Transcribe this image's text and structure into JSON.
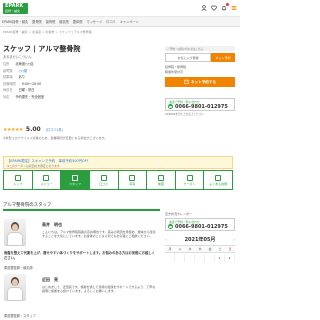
{
  "header": {
    "logo": "EPARK",
    "logo_sub": "接骨・鍼灸",
    "icons": [
      "user-icon",
      "heart-icon",
      "bell-icon",
      "menu-icon"
    ]
  },
  "nav": {
    "items": [
      "EPARK接骨・鍼灸",
      "整骨院",
      "接骨院",
      "鍼灸院",
      "整体院",
      "マッサージ",
      "口コミ",
      "キャンペーン"
    ]
  },
  "breadcrumb": "EPARK接骨・鍼灸 > 北海道 > 札幌市 > スケッフ | アルマ整骨院",
  "clinic": {
    "title": "スケッフ | アルマ整骨院",
    "subtitle": "あるませいこついん",
    "info": [
      {
        "key": "住所",
        "value": "北海道○○区"
      },
      {
        "key": "最寄駅",
        "value": "○○駅"
      },
      {
        "key": "駐車場",
        "value": "あり"
      },
      {
        "key": "診療時間",
        "value": "9:00〜20:00"
      },
      {
        "key": "休診日",
        "value": "日曜・祝日"
      },
      {
        "key": "対応",
        "value": "予約優先・完全個室"
      }
    ],
    "rating": {
      "stars": "★★★★★",
      "score": "5.00",
      "reviews": "（口コミ1件）"
    },
    "notice": "※新型コロナウイルス対策のため、営業時間が変更になる場合がございます。"
  },
  "banner": {
    "title": "【EPARK限定】スキャンで予約　事前予約500円OFF",
    "sub": "※このクーポンは初回の方限定となります"
  },
  "tabs": [
    {
      "label": "トップ",
      "icon": "home-icon",
      "active": false
    },
    {
      "label": "メニュー",
      "icon": "menu-list-icon",
      "active": false
    },
    {
      "label": "スタッフ",
      "icon": "staff-icon",
      "active": true
    },
    {
      "label": "口コミ",
      "icon": "review-icon",
      "active": false
    },
    {
      "label": "写真",
      "icon": "photo-icon",
      "active": false
    },
    {
      "label": "地図",
      "icon": "map-icon",
      "active": false
    },
    {
      "label": "クーポン",
      "icon": "coupon-icon",
      "active": false
    },
    {
      "label": "よくある質問",
      "icon": "faq-icon",
      "active": false
    }
  ],
  "staff_section": {
    "heading": "アルマ整骨院のスタッフ",
    "staff": [
      {
        "name": "高井　明也",
        "text": "こんにちは。アルマ整骨院院長の高井明也です。痛みの原因を見極め、根本から改善することを大切にしています。お身体のことなら何でもお気軽にご相談ください。",
        "quote": "骨盤を整えて代謝を上げ、痩せやすい体づくりをサポートします。お悩みのある方はお気軽にお越しください。",
        "role": "柔道整復師・鍼灸師"
      },
      {
        "name": "近田　亮",
        "text": "はじめまして、近田亮です。施術を通して皆様の健康をサポートできるよう、丁寧な説明と施術を心掛けています。よろしくお願いします。",
        "role": "柔道整復師・スタッフ"
      }
    ]
  },
  "sidebar": {
    "top_note": "ご予約・お問い合わせはこちら",
    "fav_label": "お気に入り登録",
    "fav_action": "ネット予約",
    "lines": [
      "接骨院・整骨院",
      "時間外受付可"
    ],
    "reserve_label": "ネット予約する",
    "phone_caption": "電話で予約・問い合わせ",
    "phone_number": "0066-9801-012975",
    "phone_note": "※EPARKを見たとお伝えください",
    "calendar_title": "空き状況カレンダー",
    "calendar_month": "2021年05月",
    "weekdays": [
      "月",
      "火",
      "水",
      "木",
      "金",
      "土",
      "日"
    ],
    "first_week": [
      "",
      "",
      "",
      "",
      "",
      "1",
      "2"
    ]
  },
  "colors": {
    "brand_green": "#2a9d3e",
    "accent_orange": "#f08300",
    "link_blue": "#2a7bd6",
    "star_gold": "#f5a623"
  }
}
